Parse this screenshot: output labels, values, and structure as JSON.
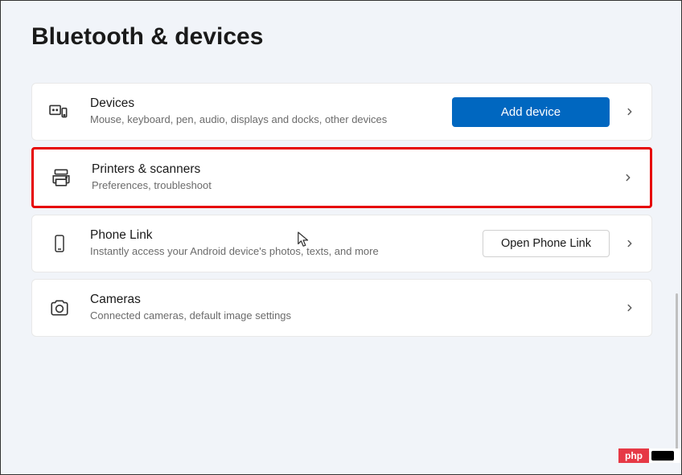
{
  "page": {
    "title": "Bluetooth & devices"
  },
  "items": [
    {
      "icon": "devices",
      "title": "Devices",
      "subtitle": "Mouse, keyboard, pen, audio, displays and docks, other devices",
      "action_label": "Add device",
      "action_type": "primary",
      "highlighted": false
    },
    {
      "icon": "printer",
      "title": "Printers & scanners",
      "subtitle": "Preferences, troubleshoot",
      "action_label": null,
      "action_type": null,
      "highlighted": true
    },
    {
      "icon": "phone",
      "title": "Phone Link",
      "subtitle": "Instantly access your Android device's photos, texts, and more",
      "action_label": "Open Phone Link",
      "action_type": "secondary",
      "highlighted": false
    },
    {
      "icon": "camera",
      "title": "Cameras",
      "subtitle": "Connected cameras, default image settings",
      "action_label": null,
      "action_type": null,
      "highlighted": false
    }
  ],
  "watermark": {
    "text": "php"
  }
}
